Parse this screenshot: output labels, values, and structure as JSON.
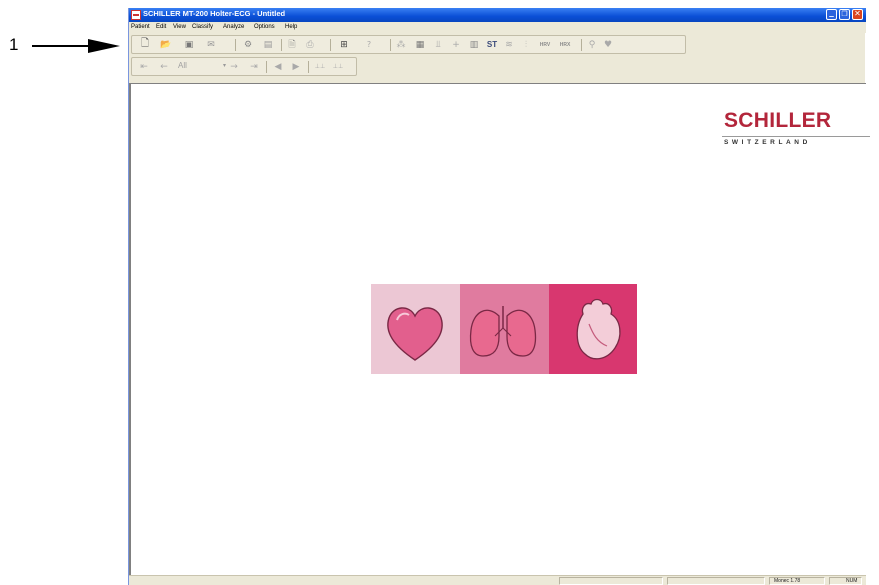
{
  "callout": {
    "number": "1"
  },
  "window": {
    "title": "SCHILLER MT-200 Holter-ECG - Untitled"
  },
  "menu": {
    "items": [
      "Patient",
      "Edit",
      "View",
      "Classify",
      "Analyze",
      "Options",
      "Help"
    ]
  },
  "toolbar1": {
    "icons": [
      "new-file-icon",
      "open-folder-icon",
      "save-icon",
      "email-icon",
      "record-icon",
      "report-icon",
      "print-preview-icon",
      "print-icon",
      "network-icon",
      "help-icon",
      "arrhythmia-icon",
      "table-icon",
      "trend-icon",
      "cursor-icon",
      "histogram-icon",
      "zoom-icon",
      "heart-icon"
    ],
    "st_label": "ST",
    "hrv_label": "HRV",
    "hrx_label": "HRX"
  },
  "toolbar2": {
    "filter_value": "All"
  },
  "logo": {
    "main": "SCHILLER",
    "sub": "SWITZERLAND"
  },
  "status": {
    "version": "Monec 1.78",
    "num": "NUM"
  },
  "colors": {
    "brand": "#b3263b",
    "titlebar": "#0a4fd6",
    "tile_light": "#e9c3d1",
    "tile_mid": "#df7a9d",
    "tile_dark": "#d8366e"
  }
}
